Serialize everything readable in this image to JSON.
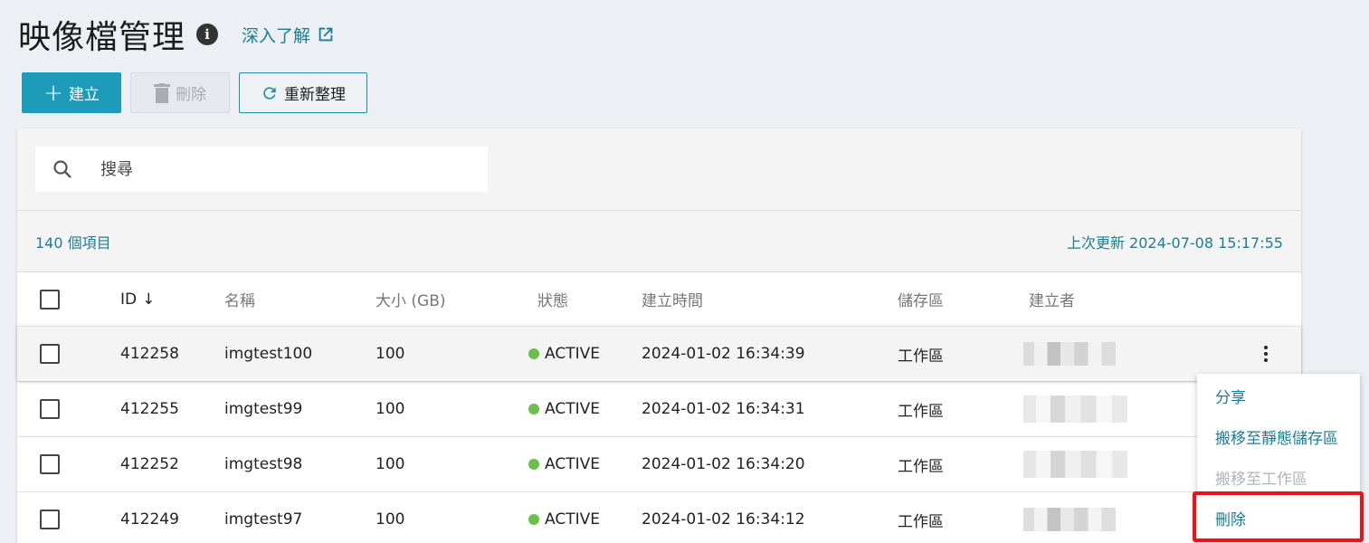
{
  "header": {
    "title": "映像檔管理",
    "info_glyph": "i",
    "learn_more": "深入了解"
  },
  "toolbar": {
    "create": "建立",
    "delete": "刪除",
    "refresh": "重新整理"
  },
  "search": {
    "placeholder": "搜尋"
  },
  "summary": {
    "count": "140 個項目",
    "last_updated": "上次更新 2024-07-08 15:17:55"
  },
  "table": {
    "columns": {
      "id": "ID",
      "name": "名稱",
      "size": "大小 (GB)",
      "status": "狀態",
      "created": "建立時間",
      "zone": "儲存區",
      "owner": "建立者"
    },
    "rows": [
      {
        "id": "412258",
        "name": "imgtest100",
        "size": "100",
        "status": "ACTIVE",
        "created": "2024-01-02 16:34:39",
        "zone": "工作區"
      },
      {
        "id": "412255",
        "name": "imgtest99",
        "size": "100",
        "status": "ACTIVE",
        "created": "2024-01-02 16:34:31",
        "zone": "工作區"
      },
      {
        "id": "412252",
        "name": "imgtest98",
        "size": "100",
        "status": "ACTIVE",
        "created": "2024-01-02 16:34:20",
        "zone": "工作區"
      },
      {
        "id": "412249",
        "name": "imgtest97",
        "size": "100",
        "status": "ACTIVE",
        "created": "2024-01-02 16:34:12",
        "zone": "工作區"
      }
    ]
  },
  "context_menu": {
    "items": [
      {
        "label": "分享",
        "enabled": true
      },
      {
        "label": "搬移至靜態儲存區",
        "enabled": true
      },
      {
        "label": "搬移至工作區",
        "enabled": false
      },
      {
        "label": "刪除",
        "enabled": true
      }
    ]
  },
  "colors": {
    "accent": "#1d9bb8",
    "link": "#1a7f96",
    "status_active": "#6cc04a",
    "highlight": "#e8141c"
  },
  "icons": [
    "info-icon",
    "external-link-icon",
    "plus-icon",
    "trash-icon",
    "refresh-icon",
    "search-icon",
    "sort-down-icon",
    "kebab-menu-icon"
  ]
}
